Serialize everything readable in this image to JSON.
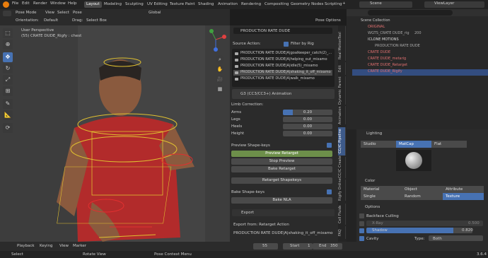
{
  "topbar": {
    "menus": [
      "File",
      "Edit",
      "Render",
      "Window",
      "Help"
    ],
    "workspaces": [
      "Layout",
      "Modeling",
      "Sculpting",
      "UV Editing",
      "Texture Paint",
      "Shading",
      "Animation",
      "Rendering",
      "Compositing",
      "Geometry Nodes",
      "Scripting"
    ],
    "scene_label": "Scene",
    "view_layer_label": "ViewLayer"
  },
  "viewport_header": {
    "mode": "Pose Mode",
    "menus": [
      "View",
      "Select",
      "Pose"
    ],
    "transform": "Global",
    "orientation_label": "Orientation:",
    "orientation_value": "Default",
    "drag_label": "Drag:",
    "drag_value": "Select Box",
    "options": "Pose Options"
  },
  "viewport": {
    "perspective": "User Perspective",
    "object_info": "(55) CRATE DUDE_Rigfy : chest"
  },
  "addon_panel": {
    "target_name": "PRODUCTION RATE DUDE",
    "source_action_label": "Source Action:",
    "filter_by_rig": "Filter by Rig",
    "actions": [
      "PRODUCTION RATE DUDE|A|goalkeeper_catch(2)_...",
      "PRODUCTION RATE DUDE|A|helping_out_mixamo",
      "PRODUCTION RATE DUDE|A|idle(5)_mixamo",
      "PRODUCTION RATE DUDE|A|shaking_it_off_mixamo",
      "PRODUCTION RATE DUDE|A|walk_mixamo"
    ],
    "animation_type": "G3 (CC3/CC3+) Animation",
    "limb_correction_label": "Limb Correction:",
    "limbs": [
      {
        "label": "Arms",
        "value": "0.20"
      },
      {
        "label": "Legs",
        "value": "0.00"
      },
      {
        "label": "Heels",
        "value": "0.00"
      },
      {
        "label": "Height",
        "value": "0.00"
      }
    ],
    "preview_shapekeys_label": "Preview Shape-keys",
    "preview_retarget": "Preview Retarget",
    "stop_preview": "Stop Preview",
    "bake_retarget": "Bake Retarget",
    "retarget_shapekeys": "Retarget Shapekeys",
    "bake_shapekeys_label": "Bake Shape-keys",
    "bake_nla": "Bake NLA",
    "export_label": "Export",
    "export_from_label": "Export from: Retarget Action",
    "export_action": "PRODUCTION RATE DUDE|A|shaking_it_off_mixamo"
  },
  "side_tabs": [
    "Tool",
    "Real Motion",
    "Edit",
    "Dynamic Parent",
    "Animation",
    "CC/iC Pipeline",
    "CC/iC Create",
    "Rigify Online",
    "Cell Fluids",
    "FAQ"
  ],
  "outliner": {
    "header": "Scene Collection",
    "rows": [
      {
        "name": "ORIGINAL",
        "color": "#e07070"
      },
      {
        "name": "WGTS_CRATE DUDE_rig",
        "extra": "200",
        "color": "#aaaaaa"
      },
      {
        "name": "ICLONE MOTIONS",
        "color": "#dddddd"
      },
      {
        "name": "PRODUCTION RATE DUDE",
        "color": "#aaaaaa"
      },
      {
        "name": "CRATE DUDE",
        "color": "#e07070"
      },
      {
        "name": "CRATE DUDE_metarig",
        "color": "#e07070"
      },
      {
        "name": "CRATE DUDE_Retarget",
        "color": "#e07070"
      },
      {
        "name": "CRATE DUDE_Rigify",
        "color": "#e07070"
      }
    ]
  },
  "properties": {
    "lighting_label": "Lighting",
    "lighting_options": [
      "Studio",
      "MatCap",
      "Flat"
    ],
    "lighting_selected": "MatCap",
    "color_label": "Color",
    "color_options": [
      "Material",
      "Object",
      "Attribute",
      "Single",
      "Random",
      "Texture"
    ],
    "color_selected": "Texture",
    "options_label": "Options",
    "backface_culling": "Backface Culling",
    "xray_label": "X-Ray",
    "xray_value": "0.500",
    "shadow_label": "Shadow",
    "shadow_value": "0.820",
    "cavity_label": "Cavity",
    "type_label": "Type:",
    "type_value": "Both",
    "world_space": "World Space"
  },
  "timeline": {
    "menus": [
      "Playback",
      "Keying",
      "View",
      "Marker"
    ],
    "current_frame": "55",
    "start_label": "Start",
    "start": "1",
    "end_label": "End",
    "end": "350"
  },
  "statusbar": {
    "select": "Select",
    "rotate_view": "Rotate View",
    "context_menu": "Pose Context Menu",
    "version": "3.6.4"
  }
}
